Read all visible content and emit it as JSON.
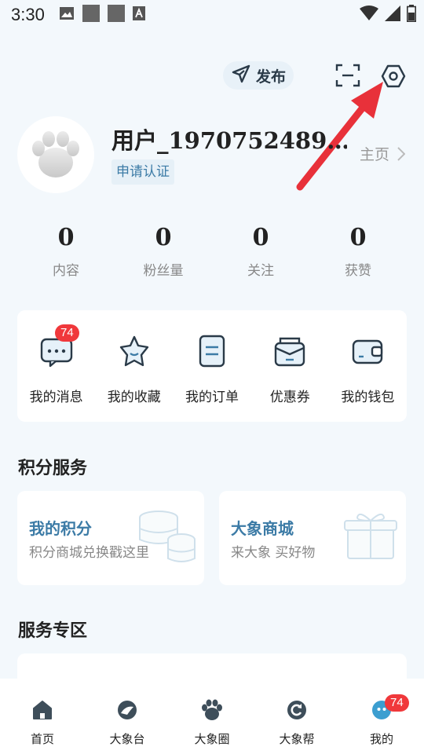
{
  "status_bar": {
    "time": "3:30"
  },
  "topbar": {
    "publish_label": "发布"
  },
  "profile": {
    "username": "用户_1970752489…",
    "verify_label": "申请认证",
    "homepage_label": "主页"
  },
  "stats": [
    {
      "value": "0",
      "label": "内容"
    },
    {
      "value": "0",
      "label": "粉丝量"
    },
    {
      "value": "0",
      "label": "关注"
    },
    {
      "value": "0",
      "label": "获赞"
    }
  ],
  "quick_actions": [
    {
      "label": "我的消息",
      "badge": "74",
      "icon": "message-icon"
    },
    {
      "label": "我的收藏",
      "icon": "star-icon"
    },
    {
      "label": "我的订单",
      "icon": "order-icon"
    },
    {
      "label": "优惠券",
      "icon": "coupon-icon"
    },
    {
      "label": "我的钱包",
      "icon": "wallet-icon"
    }
  ],
  "points_section": {
    "title": "积分服务",
    "cards": [
      {
        "title": "我的积分",
        "subtitle": "积分商城兑换戳这里",
        "icon": "coins-icon"
      },
      {
        "title": "大象商城",
        "subtitle": "来大象  买好物",
        "icon": "gift-box-icon"
      }
    ]
  },
  "service_section": {
    "title": "服务专区"
  },
  "tabbar": [
    {
      "label": "首页",
      "icon": "home-icon"
    },
    {
      "label": "大象台",
      "icon": "elephant-tv-icon"
    },
    {
      "label": "大象圈",
      "icon": "paw-icon"
    },
    {
      "label": "大象帮",
      "icon": "help-icon"
    },
    {
      "label": "我的",
      "icon": "profile-icon",
      "badge": "74"
    }
  ],
  "colors": {
    "accent": "#3c7ba6",
    "badge": "#f0383b",
    "arrow": "#e8313a",
    "background": "#f3f8fc"
  }
}
